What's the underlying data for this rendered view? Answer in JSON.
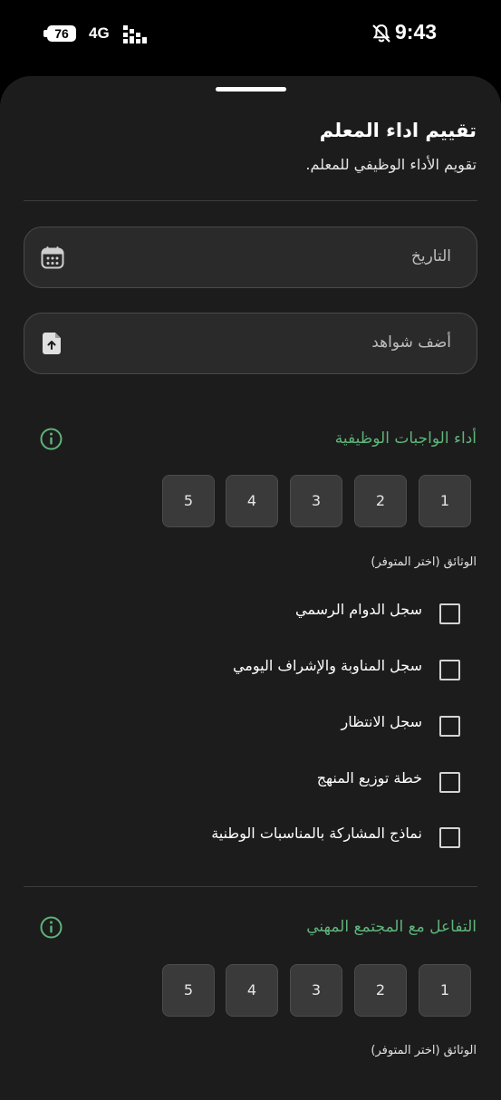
{
  "status_bar": {
    "battery": "76",
    "network": "4G",
    "time": "9:43"
  },
  "form": {
    "title": "تقييم اداء المعلم",
    "subtitle": "تقويم الأداء الوظيفي للمعلم.",
    "date_placeholder": "التاريخ",
    "evidence_placeholder": "أضف شواهد"
  },
  "sections": [
    {
      "title": "أداء الواجبات الوظيفية",
      "ratings": [
        "1",
        "2",
        "3",
        "4",
        "5"
      ],
      "docs_label": "الوثائق (اختر المتوفر)",
      "checkboxes": [
        "سجل الدوام الرسمي",
        "سجل المناوبة والإشراف اليومي",
        "سجل الانتظار",
        "خطة توزيع المنهج",
        "نماذج المشاركة بالمناسبات الوطنية"
      ]
    },
    {
      "title": "التفاعل مع المجتمع المهني",
      "ratings": [
        "1",
        "2",
        "3",
        "4",
        "5"
      ],
      "docs_label": "الوثائق (اختر المتوفر)"
    }
  ],
  "colors": {
    "accent_green": "#5fb47a",
    "sheet_bg": "#1c1c1c",
    "field_bg": "#2a2a2a"
  }
}
